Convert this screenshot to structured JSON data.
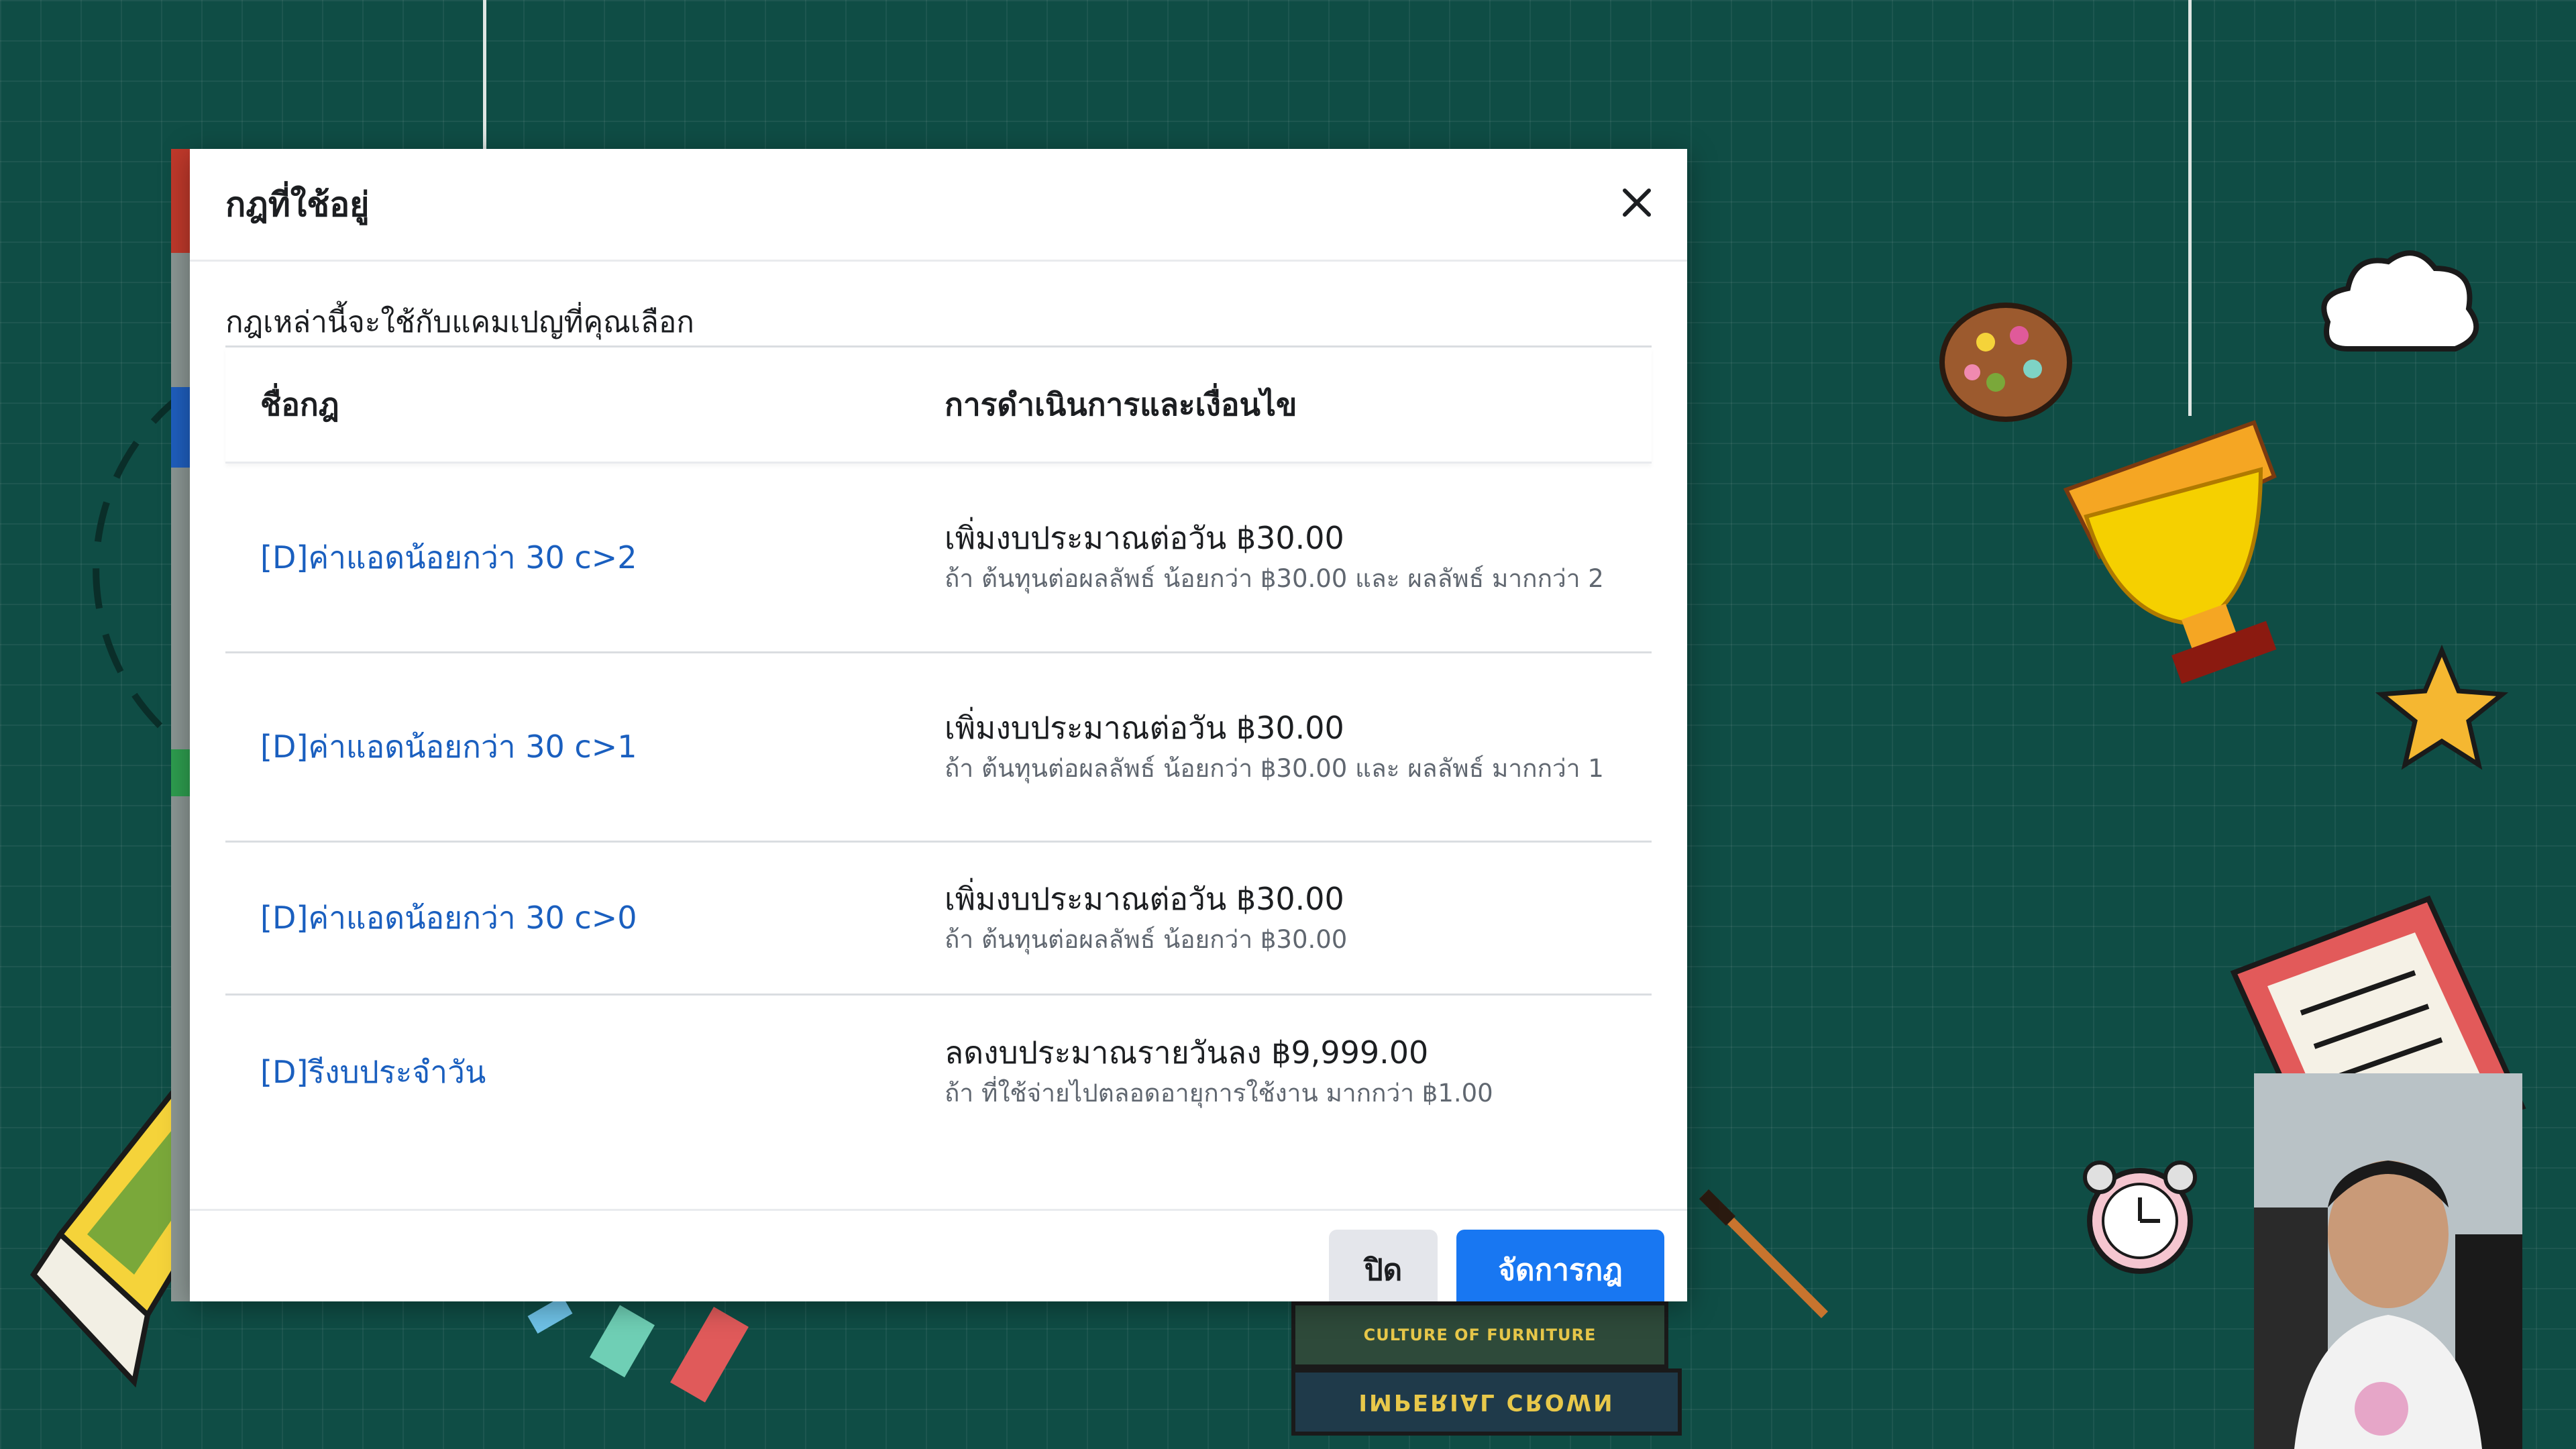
{
  "modal": {
    "title": "กฎที่ใช้อยู่",
    "description": "กฎเหล่านี้จะใช้กับแคมเปญที่คุณเลือก",
    "columns": {
      "name": "ชื่อกฎ",
      "actions": "การดำเนินการและเงื่อนไข"
    },
    "rules": [
      {
        "name": "[D]ค่าแอดน้อยกว่า 30 c>2",
        "action": "เพิ่มงบประมาณต่อวัน ฿30.00",
        "condition": "ถ้า ต้นทุนต่อผลลัพธ์ น้อยกว่า ฿30.00 และ ผลลัพธ์ มากกว่า 2"
      },
      {
        "name": "[D]ค่าแอดน้อยกว่า 30 c>1",
        "action": "เพิ่มงบประมาณต่อวัน ฿30.00",
        "condition": "ถ้า ต้นทุนต่อผลลัพธ์ น้อยกว่า ฿30.00 และ ผลลัพธ์ มากกว่า 1"
      },
      {
        "name": "[D]ค่าแอดน้อยกว่า 30 c>0",
        "action": "เพิ่มงบประมาณต่อวัน ฿30.00",
        "condition": "ถ้า ต้นทุนต่อผลลัพธ์ น้อยกว่า ฿30.00"
      },
      {
        "name": "[D]รีงบประจำวัน",
        "action": "ลดงบประมาณรายวันลง ฿9,999.00",
        "condition": "ถ้า ที่ใช้จ่ายไปตลอดอายุการใช้งาน มากกว่า ฿1.00"
      }
    ],
    "buttons": {
      "close": "ปิด",
      "manage": "จัดการกฎ"
    }
  },
  "background": {
    "book_spine_1": "CULTURE OF FURNITURE",
    "book_spine_2": "IMPERIAL CROWN"
  },
  "colors": {
    "link": "#1a5fbf",
    "primary_button": "#1877f2",
    "background": "#0f4d45"
  }
}
